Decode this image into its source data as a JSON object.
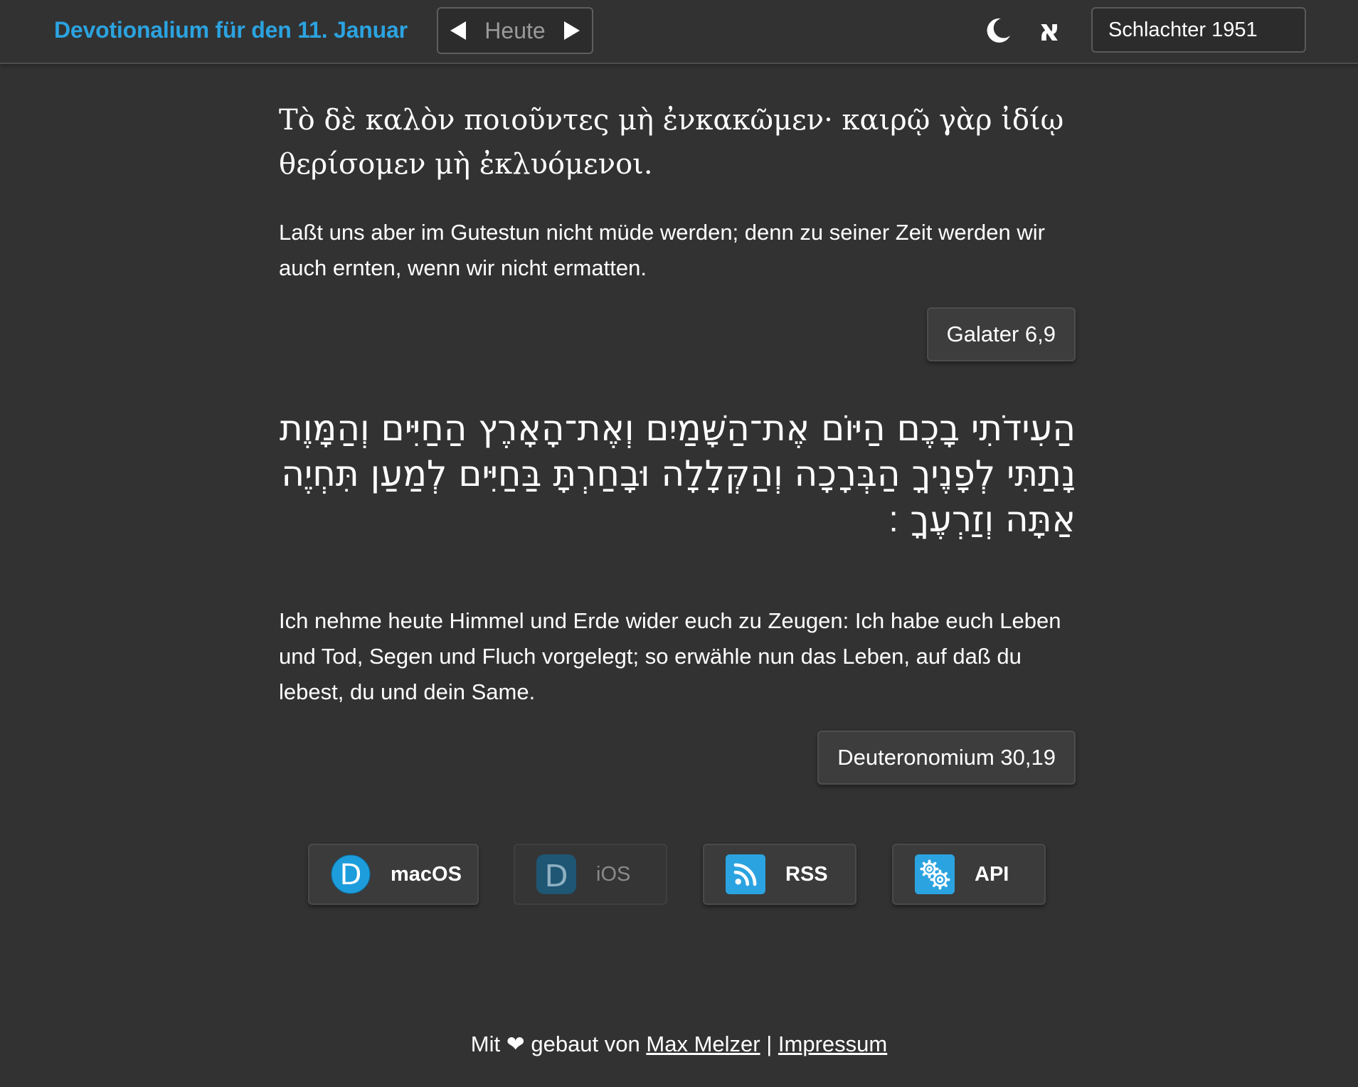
{
  "header": {
    "title": "Devotionalium für den 11. Januar",
    "today_label": "Heute",
    "prev_icon": "triangle-left-icon",
    "next_icon": "triangle-right-icon",
    "dark_mode_icon": "moon-icon",
    "hebrew_icon": "aleph-icon",
    "aleph_glyph": "א",
    "bible_version": "Schlachter 1951",
    "accent_color": "#2ba3e0"
  },
  "verses": [
    {
      "original": "Τὸ δὲ καλὸν ποιοῦντες μὴ ἐνκακῶμεν· καιρῷ γὰρ ἰδίῳ θερίσομεν μὴ ἐκλυόμενοι.",
      "translation": "Laßt uns aber im Gutestun nicht müde werden; denn zu seiner Zeit werden wir auch ernten, wenn wir nicht ermatten.",
      "reference": "Galater 6,9"
    },
    {
      "original": "הַעִידֹתִי בָכֶם הַיּוֹם אֶת־הַשָּׁמַיִם וְאֶת־הָאָרֶץ הַחַיִּים וְהַמָּוֶת נָתַתִּי לְפָנֶיךָ הַבְּרָכָה וְהַקְּלָלָה וּבָחַרְתָּ בַּחַיִּים לְמַעַן תִּחְיֶה אַתָּה וְזַרְעֶךָ ׃",
      "translation": "Ich nehme heute Himmel und Erde wider euch zu Zeugen: Ich habe euch Leben und Tod, Segen und Fluch vorgelegt; so erwähle nun das Leben, auf daß du lebest, du und dein Same.",
      "reference": "Deuteronomium 30,19"
    }
  ],
  "apps": [
    {
      "label": "macOS",
      "icon": "devotionalium-d-icon",
      "enabled": true
    },
    {
      "label": "iOS",
      "icon": "devotionalium-d-icon",
      "enabled": false
    },
    {
      "label": "RSS",
      "icon": "rss-icon",
      "enabled": true
    },
    {
      "label": "API",
      "icon": "gears-icon",
      "enabled": true
    }
  ],
  "footer": {
    "prefix": "Mit",
    "heart": "❤",
    "middle": "gebaut von",
    "author": "Max Melzer",
    "separator": "|",
    "imprint": "Impressum"
  }
}
